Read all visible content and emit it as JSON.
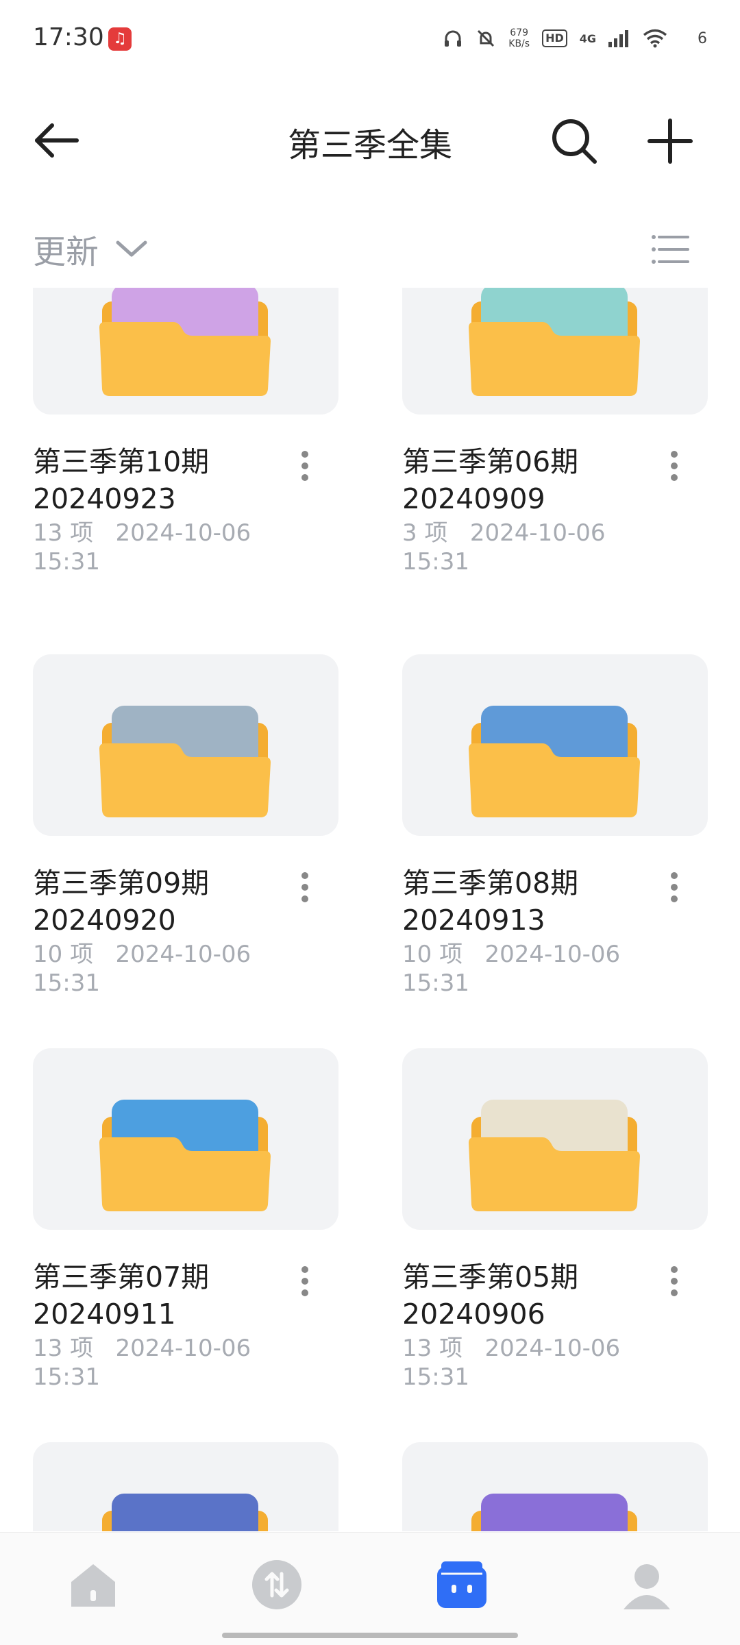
{
  "status_bar": {
    "time": "17:30",
    "speed_value": "679",
    "speed_unit": "KB/s",
    "hd": "HD",
    "network": "4G",
    "battery": "6",
    "icons": [
      "netease-music-icon",
      "headphones-icon",
      "bell-off-icon",
      "signal-icon",
      "wifi-icon"
    ]
  },
  "header": {
    "title": "第三季全集",
    "back_icon": "arrow-left-icon",
    "search_icon": "search-icon",
    "add_icon": "plus-icon"
  },
  "sort": {
    "label": "更新",
    "icon": "chevron-down-icon",
    "view_icon": "list-view-icon"
  },
  "items": [
    {
      "name": "第三季第10期\n20240923",
      "count": "13 项",
      "date": "2024-10-06",
      "time": "15:31",
      "preview": "#cfa3e6"
    },
    {
      "name": "第三季第06期\n20240909",
      "count": "3 项",
      "date": "2024-10-06",
      "time": "15:31",
      "preview": "#8fd3cf"
    },
    {
      "name": "第三季第09期\n20240920",
      "count": "10 项",
      "date": "2024-10-06",
      "time": "15:31",
      "preview": "#9fb3c4"
    },
    {
      "name": "第三季第08期\n20240913",
      "count": "10 项",
      "date": "2024-10-06",
      "time": "15:31",
      "preview": "#5f9ad8"
    },
    {
      "name": "第三季第07期\n20240911",
      "count": "13 项",
      "date": "2024-10-06",
      "time": "15:31",
      "preview": "#4d9fe0"
    },
    {
      "name": "第三季第05期\n20240906",
      "count": "13 项",
      "date": "2024-10-06",
      "time": "15:31",
      "preview": "#e9e2cf"
    },
    {
      "name": "",
      "count": "",
      "date": "",
      "time": "",
      "preview": "#5a73c8"
    },
    {
      "name": "",
      "count": "",
      "date": "",
      "time": "",
      "preview": "#8a6fd8"
    }
  ],
  "colors": {
    "folder": "#fbbf49",
    "folder_back": "#f4ad31",
    "accent": "#2f6ef6",
    "nav_inactive": "#c9cbce"
  },
  "nav": [
    {
      "icon": "home-icon",
      "active": false
    },
    {
      "icon": "transfer-icon",
      "active": false
    },
    {
      "icon": "files-icon",
      "active": true
    },
    {
      "icon": "profile-icon",
      "active": false
    }
  ]
}
